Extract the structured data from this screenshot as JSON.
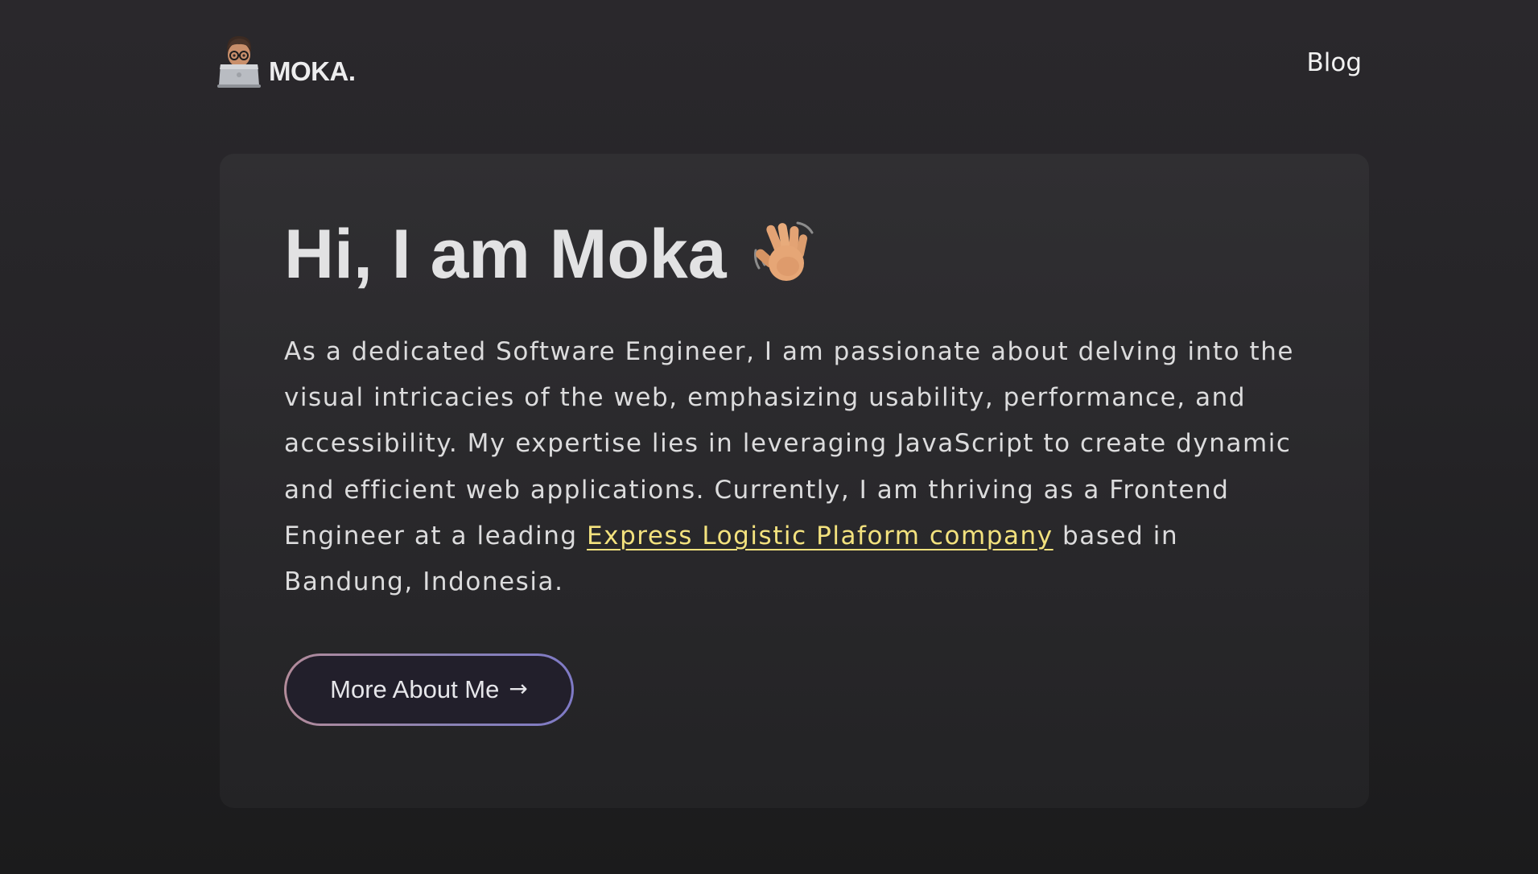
{
  "header": {
    "logo_text": "MOKA.",
    "avatar_icon": "memoji-laptop-icon",
    "nav": {
      "blog_label": "Blog"
    }
  },
  "hero": {
    "title": "Hi, I am Moka",
    "title_icon": "waving-hand-icon",
    "description_before_link": "As a dedicated Software Engineer, I am passionate about delving into the visual intricacies of the web, emphasizing usability, performance, and accessibility. My expertise lies in leveraging JavaScript to create dynamic and efficient web applications. Currently, I am thriving as a Frontend Engineer at a leading ",
    "description_link": "Express Logistic Plaform company",
    "description_after_link": " based in Bandung, Indonesia.",
    "button_label": "More About Me",
    "button_icon": "arrow-right-icon",
    "button_arrow": "→"
  },
  "colors": {
    "background": "#252427",
    "card": "#2e2d30",
    "link": "#f3e27e",
    "button_border_start": "#b38b9a",
    "button_border_end": "#7f7ac6",
    "button_fill": "#221f2b"
  }
}
